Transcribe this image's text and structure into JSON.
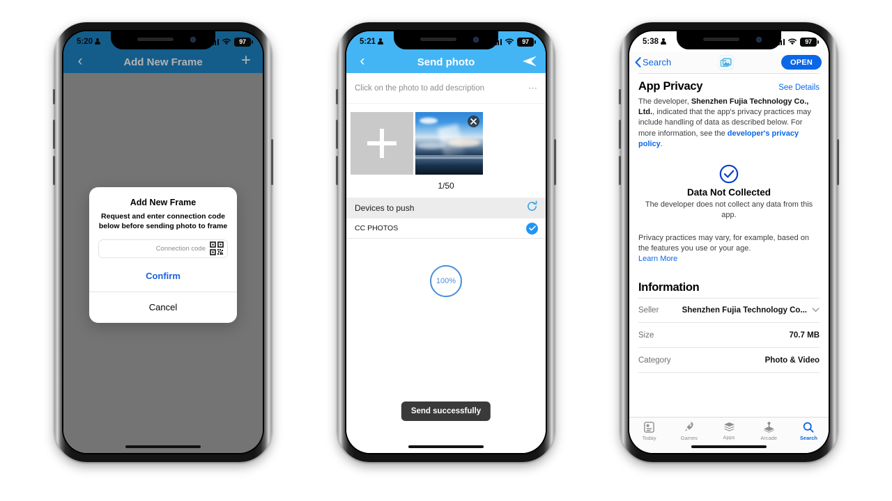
{
  "phone1": {
    "status": {
      "time": "5:20",
      "battery": "97"
    },
    "navbar": {
      "back_icon": "chevron-left-icon",
      "title": "Add New Frame",
      "add_icon": "plus-icon"
    },
    "alert": {
      "title": "Add New Frame",
      "message": "Request and enter connection code below before sending photo to frame",
      "input_placeholder": "Connection code",
      "input_value": "",
      "qr_icon": "qr-code-icon",
      "confirm_label": "Confirm",
      "cancel_label": "Cancel"
    }
  },
  "phone2": {
    "status": {
      "time": "5:21",
      "battery": "97"
    },
    "navbar": {
      "back_icon": "chevron-left-icon",
      "title": "Send photo",
      "send_icon": "send-paper-plane-icon"
    },
    "description_row": {
      "text": "Click on the photo to add description",
      "more_icon": "ellipsis-icon"
    },
    "thumbnails": {
      "add_label": "plus-icon",
      "photo_alt": "sunset-over-ocean-photo",
      "remove_icon": "close-circle-icon"
    },
    "count": "1/50",
    "devices_header": {
      "title": "Devices to push",
      "refresh_icon": "refresh-icon"
    },
    "devices": [
      {
        "name": "CC PHOTOS",
        "selected_icon": "check-circle-icon"
      }
    ],
    "progress": {
      "value": "100%"
    },
    "toast": {
      "text": "Send successfully"
    }
  },
  "phone3": {
    "status": {
      "time": "5:38",
      "battery": "97"
    },
    "navbar": {
      "back_icon": "chevron-left-icon",
      "back_label": "Search",
      "app_icon": "photo-app-icon",
      "open_label": "OPEN"
    },
    "privacy": {
      "heading": "App Privacy",
      "see_details": "See Details",
      "paragraph_1": "The developer, ",
      "developer_name": "Shenzhen Fujia Technology Co., Ltd.",
      "paragraph_2": ", indicated that the app's privacy practices may include handling of data as described below. For more information, see the ",
      "policy_link": "developer's privacy policy",
      "paragraph_3": ".",
      "badge_icon": "check-circle-outline-icon",
      "badge_title": "Data Not Collected",
      "badge_subtitle": "The developer does not collect any data from this app.",
      "vary_text": "Privacy practices may vary, for example, based on the features you use or your age.",
      "learn_more": "Learn More"
    },
    "information": {
      "heading": "Information",
      "rows": [
        {
          "key": "Seller",
          "value": "Shenzhen Fujia Technology Co...",
          "has_chevron": true
        },
        {
          "key": "Size",
          "value": "70.7 MB",
          "has_chevron": false
        },
        {
          "key": "Category",
          "value": "Photo & Video",
          "has_chevron": false
        }
      ]
    },
    "tabbar": [
      {
        "label": "Today",
        "icon": "today-document-icon",
        "active": false
      },
      {
        "label": "Games",
        "icon": "rocket-icon",
        "active": false
      },
      {
        "label": "Apps",
        "icon": "stacked-layers-icon",
        "active": false
      },
      {
        "label": "Arcade",
        "icon": "joystick-icon",
        "active": false
      },
      {
        "label": "Search",
        "icon": "magnifier-icon",
        "active": true
      }
    ]
  },
  "colors": {
    "phone1_navbar": "#1d86c8",
    "phone2_navbar": "#43b5f5",
    "accent_blue": "#0a67e8",
    "progress_blue": "#4a90d9"
  }
}
